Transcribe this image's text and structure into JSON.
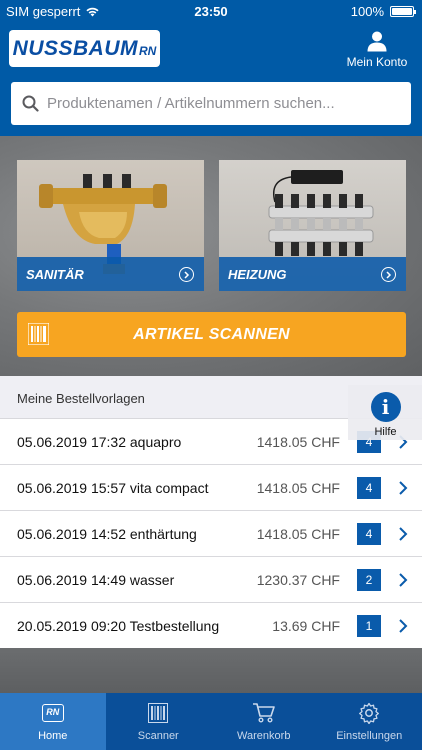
{
  "status_bar": {
    "carrier": "SIM gesperrt",
    "time": "23:50",
    "battery": "100%"
  },
  "header": {
    "logo_main": "NUSSBAUM",
    "logo_suffix": "RN",
    "account_label": "Mein Konto"
  },
  "search": {
    "placeholder": "Produktenamen / Artikelnummern suchen..."
  },
  "tiles": {
    "left_label": "SANITÄR",
    "right_label": "HEIZUNG"
  },
  "scan_button": {
    "label": "ARTIKEL SCANNEN"
  },
  "templates": {
    "header": "Meine Bestellvorlagen",
    "items": [
      {
        "label": "05.06.2019 17:32 aquapro",
        "price": "1418.05 CHF",
        "count": "4"
      },
      {
        "label": "05.06.2019 15:57 vita compact",
        "price": "1418.05 CHF",
        "count": "4"
      },
      {
        "label": "05.06.2019 14:52 enthärtung",
        "price": "1418.05 CHF",
        "count": "4"
      },
      {
        "label": "05.06.2019 14:49 wasser",
        "price": "1230.37 CHF",
        "count": "2"
      },
      {
        "label": "20.05.2019 09:20 Testbestellung",
        "price": "13.69 CHF",
        "count": "1"
      }
    ]
  },
  "help": {
    "label": "Hilfe"
  },
  "tabbar": {
    "tabs": [
      {
        "label": "Home",
        "icon": "rn-logo-icon"
      },
      {
        "label": "Scanner",
        "icon": "barcode-icon"
      },
      {
        "label": "Warenkorb",
        "icon": "cart-icon"
      },
      {
        "label": "Einstellungen",
        "icon": "gear-icon"
      }
    ]
  },
  "colors": {
    "brand_blue": "#005aa6",
    "accent_orange": "#f7a521",
    "tab_active": "#2d78c4",
    "tab_bar": "#0a4f99"
  }
}
